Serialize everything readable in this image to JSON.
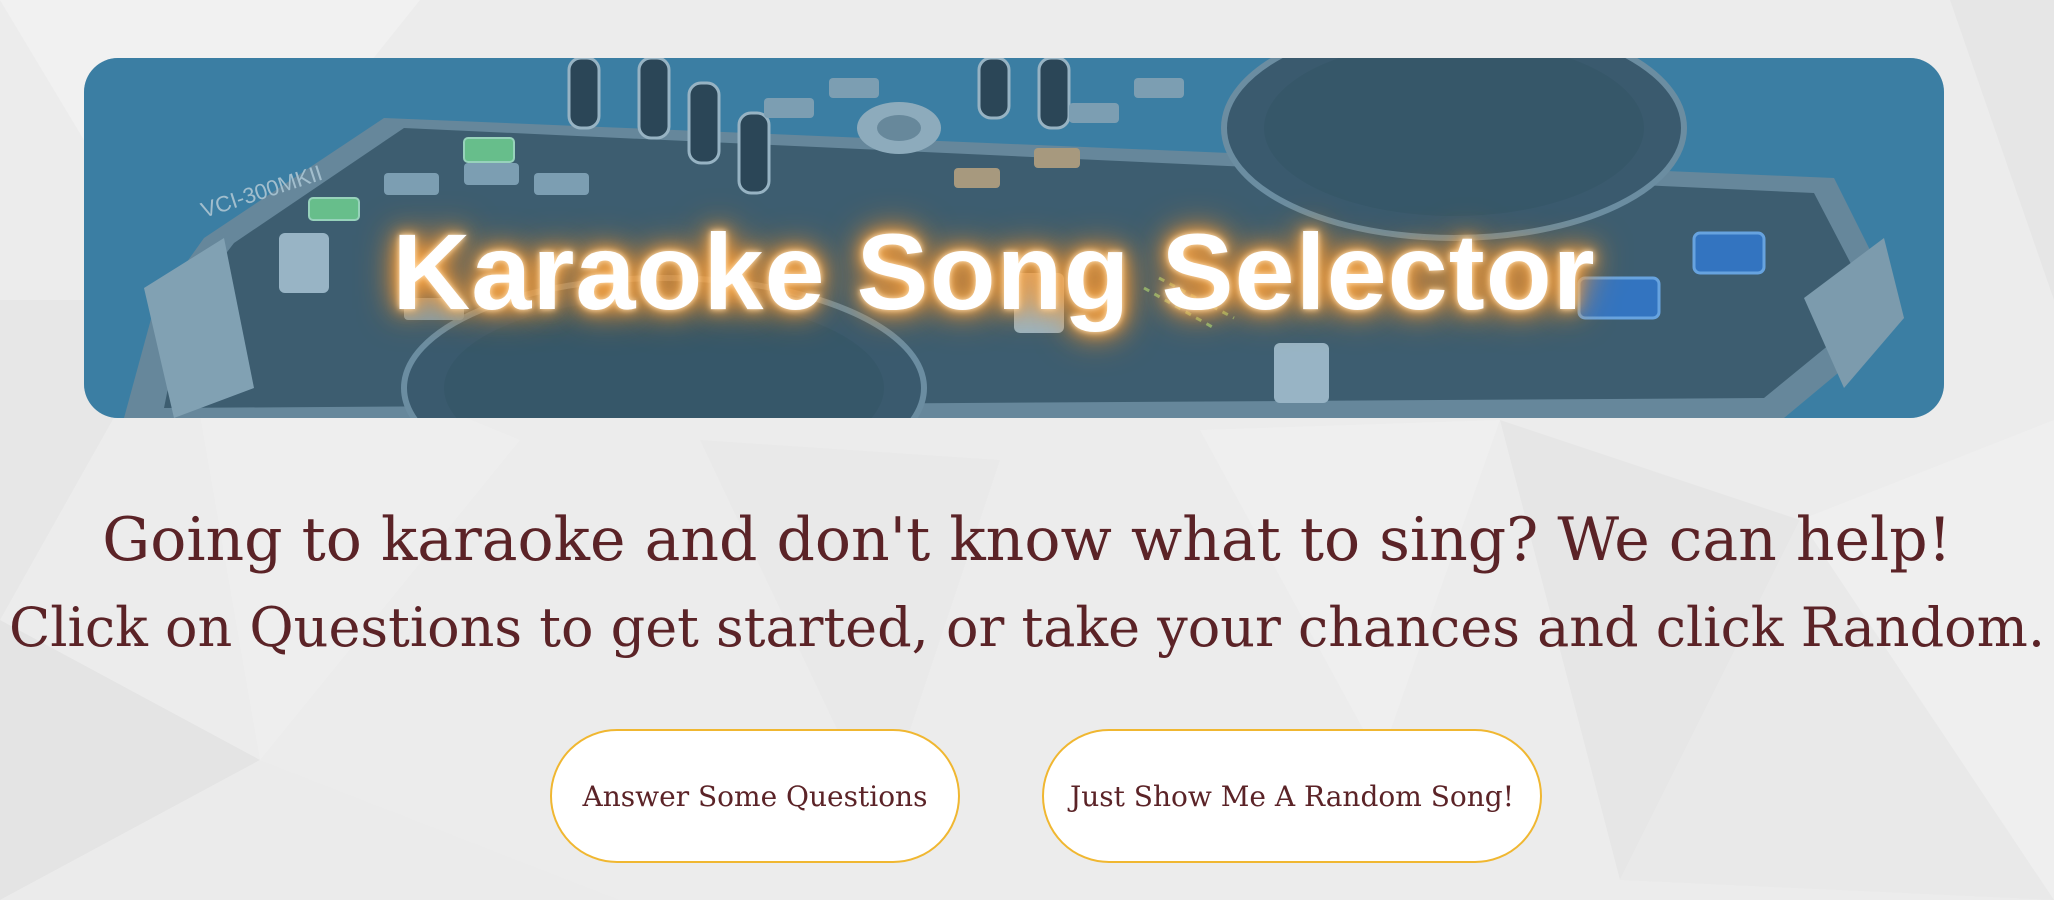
{
  "banner": {
    "title": "Karaoke Song Selector",
    "background_color": "#3b7fa3",
    "glow_color": "#ff9a2e"
  },
  "intro": {
    "line1": "Going to karaoke and don't know what to sing? We can help!",
    "line2": "Click on Questions to get started, or take your chances and click Random.",
    "text_color": "#5b2327"
  },
  "actions": {
    "questions_label": "Answer Some Questions",
    "random_label": "Just Show Me A Random Song!",
    "border_color": "#f0b731"
  }
}
